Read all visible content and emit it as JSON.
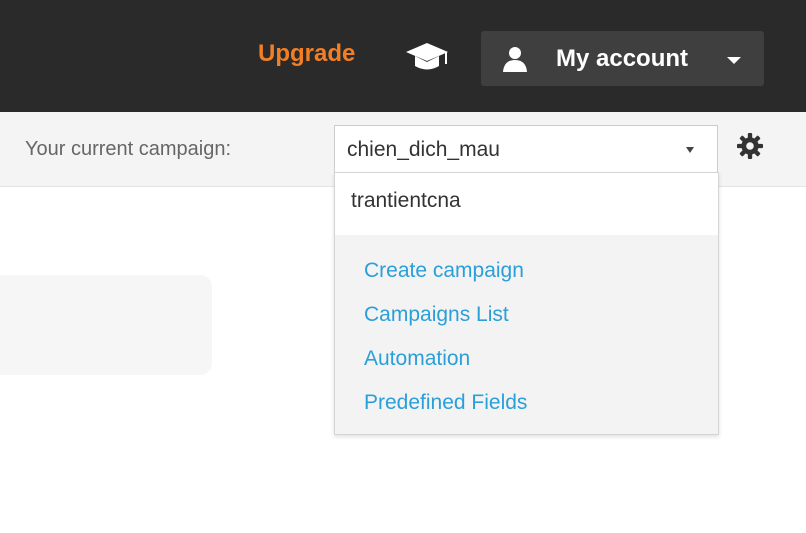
{
  "header": {
    "upgrade_label": "Upgrade",
    "help_icon": "graduation-cap-icon",
    "account_icon": "user-icon",
    "account_label": "My account",
    "account_caret_icon": "caret-down-icon",
    "background_color": "#2a2a2a",
    "upgrade_color": "#f07f26"
  },
  "campaign_bar": {
    "label": "Your current campaign:",
    "selected_value": "chien_dich_mau",
    "settings_icon": "gear-icon"
  },
  "campaign_dropdown": {
    "options": [
      "trantientcna"
    ],
    "links": [
      "Create campaign",
      "Campaigns List",
      "Automation",
      "Predefined Fields"
    ],
    "link_color": "#2a9fd8"
  }
}
